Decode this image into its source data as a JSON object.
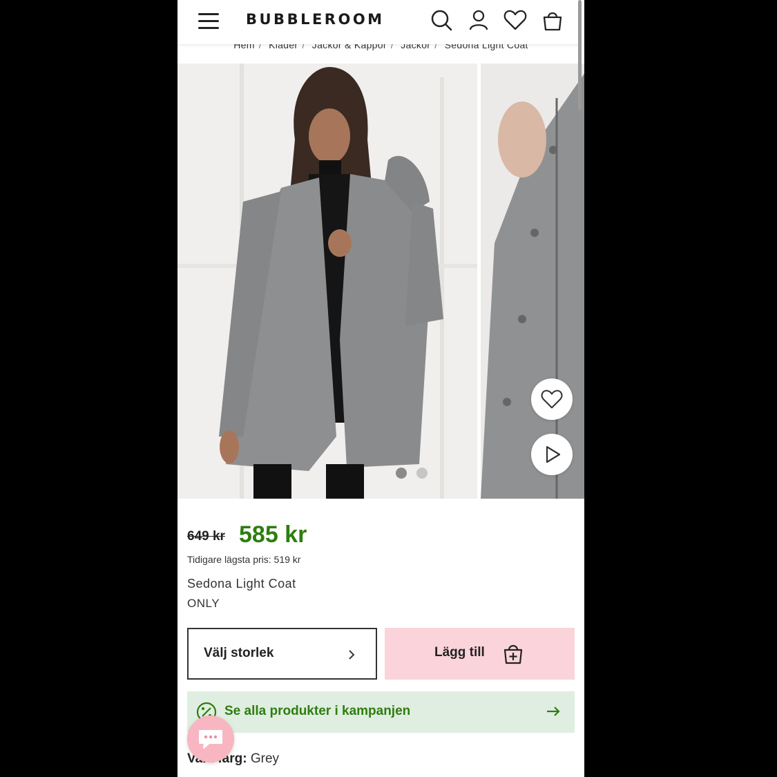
{
  "header": {
    "logo": "BUBBLEROOM",
    "icons": [
      "menu-icon",
      "search-icon",
      "account-icon",
      "heart-icon",
      "bag-icon"
    ]
  },
  "breadcrumb": [
    "Hem",
    "Kläder",
    "Jackor & Kappor",
    "Jackor",
    "Sedona Light Coat"
  ],
  "gallery": {
    "image_count": 2,
    "active_index": 0
  },
  "product": {
    "old_price": "649 kr",
    "new_price": "585 kr",
    "lowest_price_text": "Tidigare lägsta pris: 519 kr",
    "name": "Sedona Light Coat",
    "brand": "ONLY"
  },
  "actions": {
    "size_label": "Välj storlek",
    "add_label": "Lägg till"
  },
  "campaign": {
    "label": "Se alla produkter i kampanjen"
  },
  "color": {
    "label": "Vald färg:",
    "value": "Grey"
  },
  "colors": {
    "accent_green": "#2e7d10",
    "add_button_pink": "#fad4da",
    "campaign_bg": "#dfeee0",
    "chat_pink": "#f7b6c1"
  }
}
